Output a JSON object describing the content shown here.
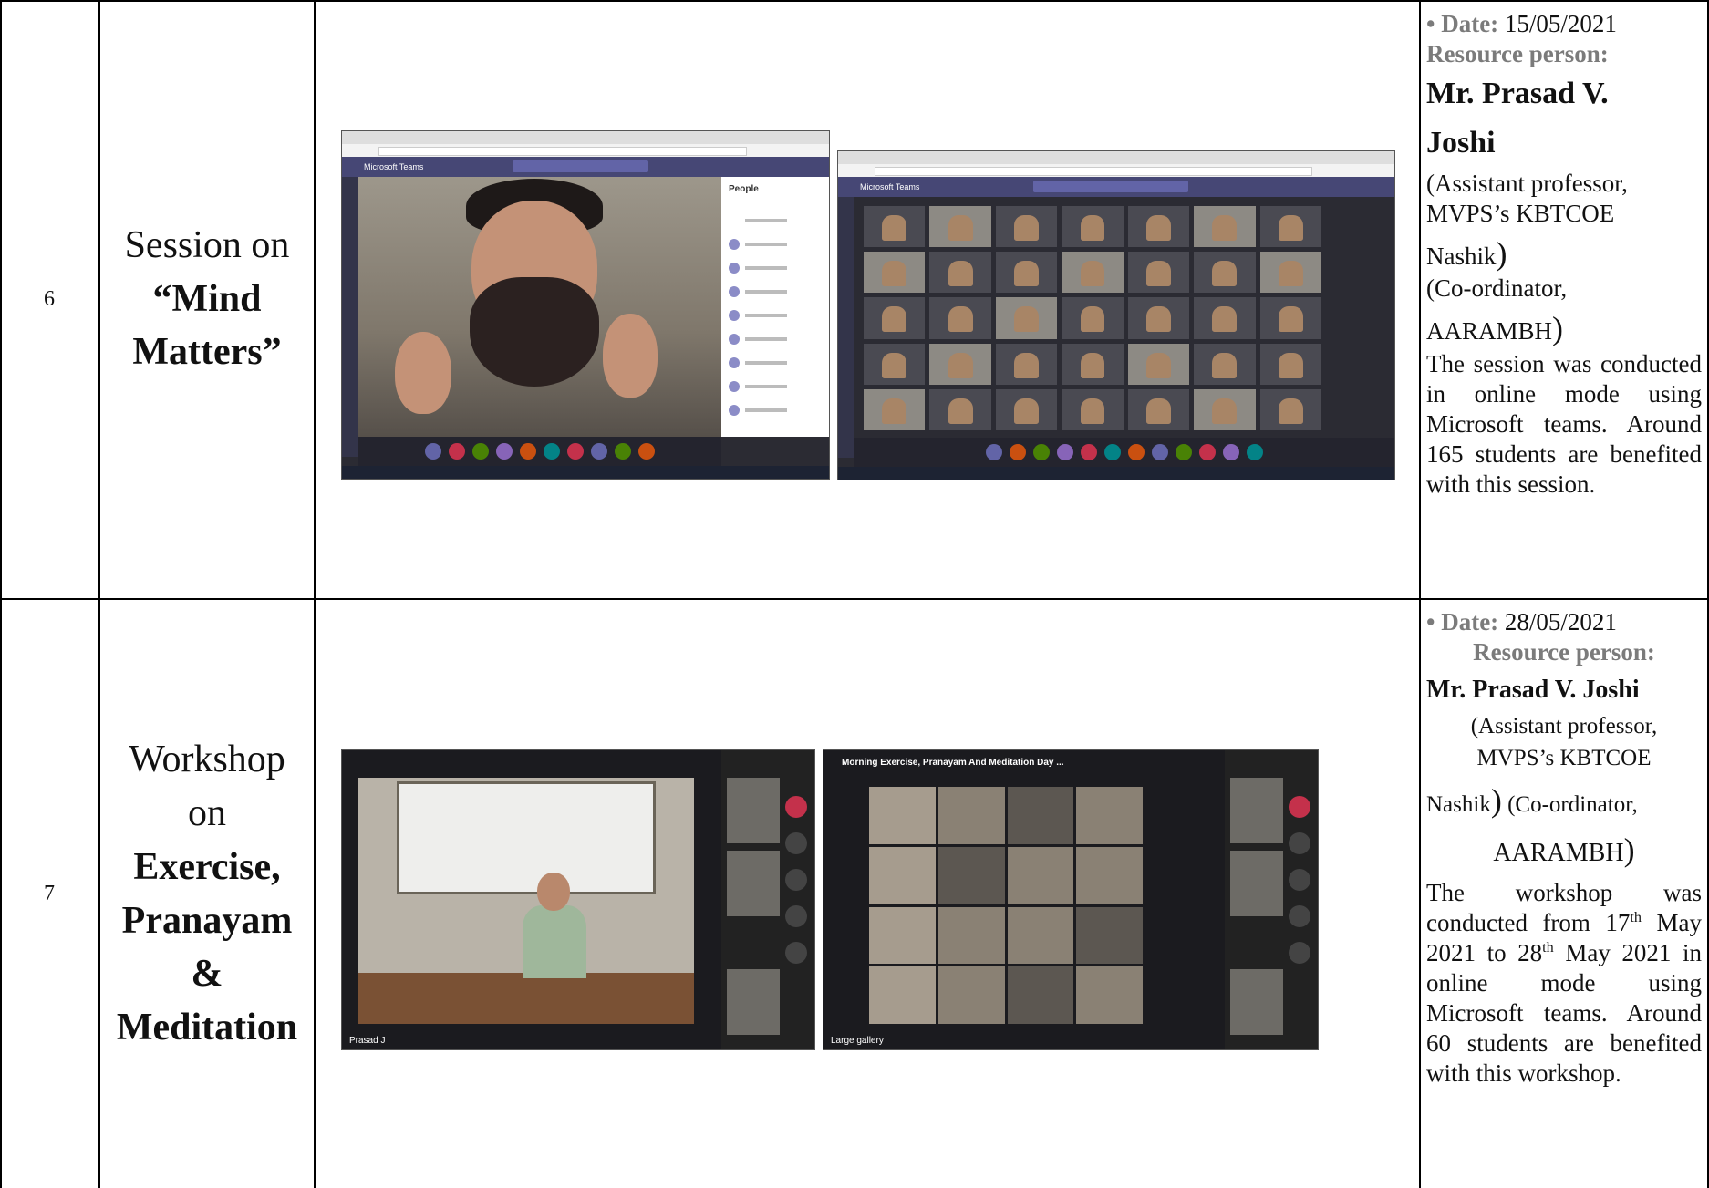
{
  "rows": [
    {
      "sno": "6",
      "title_lines": [
        "Session on",
        "“Mind",
        "Matters”"
      ],
      "images": [
        {
          "app_title": "Microsoft Teams",
          "panel_title": "People",
          "subject": "speaker-video"
        },
        {
          "app_title": "Microsoft Teams",
          "subject": "attendee-grid"
        }
      ],
      "details": {
        "date_bullet": "•",
        "date_label": "Date:",
        "date_value": "15/05/2021",
        "resource_label": "Resource person:",
        "name_line1": "Mr. Prasad V.",
        "name_line2": "Joshi",
        "affil1": "(Assistant professor, MVPS’s KBTCOE",
        "affil2": "Nashik",
        "close1": ")",
        "affil3": "(Co-ordinator,",
        "affil4": "AARAMBH",
        "close2": ")",
        "description": "The session was conducted in online mode using Microsoft teams. Around 165 students are benefited with this session."
      }
    },
    {
      "sno": "7",
      "title_lines": [
        "Workshop",
        "on",
        "Exercise,",
        "Pranayam",
        "&",
        "Meditation"
      ],
      "images": [
        {
          "caption": "Prasad J",
          "subject": "instructor-video"
        },
        {
          "header_text": "Morning Exercise, Pranayam And Meditation Day ...",
          "caption": "Large gallery",
          "subject": "attendee-gallery"
        }
      ],
      "details": {
        "date_bullet": "•",
        "date_label": "Date:",
        "date_value": "28/05/2021",
        "resource_label": "Resource person:",
        "name": "Mr. Prasad V. Joshi",
        "affil1": "(Assistant professor,",
        "affil2": "MVPS’s KBTCOE",
        "affil3": "Nashik",
        "close1": ")",
        "affil4": "(Co-ordinator,",
        "affil5": "AARAMBH",
        "close2": ")",
        "desc_a": "The workshop was conducted from 17",
        "sup1": "th",
        "desc_b": "May 2021 to 28",
        "sup2": "th",
        "desc_c": "May 2021 in online mode using Microsoft teams. Around 60 students are benefited with this workshop."
      }
    }
  ]
}
